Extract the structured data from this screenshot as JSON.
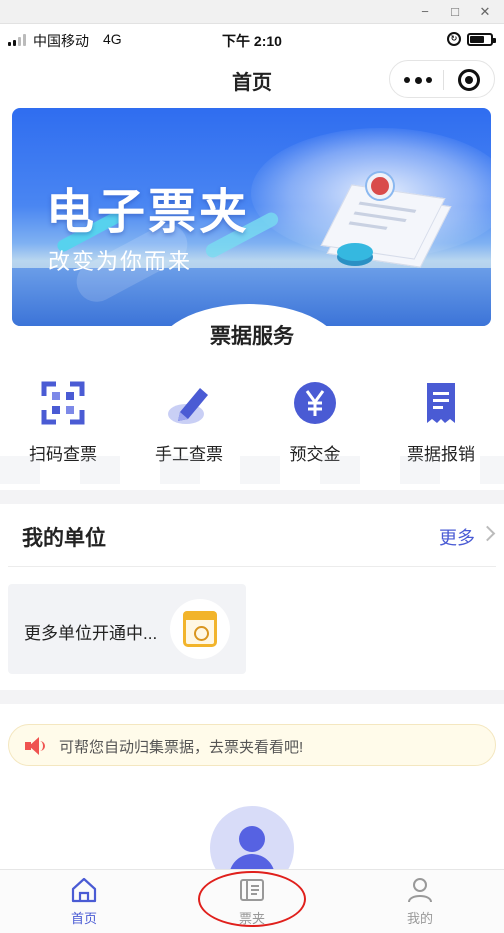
{
  "window": {
    "minimize": "−",
    "maximize": "□",
    "close": "✕"
  },
  "status_bar": {
    "carrier": "中国移动",
    "network": "4G",
    "time": "下午 2:10",
    "lock_icon": "rotation-lock-icon",
    "battery_icon": "battery-icon"
  },
  "nav": {
    "title": "首页",
    "menu_icon": "more-dots-icon",
    "close_icon": "target-icon"
  },
  "banner": {
    "title": "电子票夹",
    "subtitle": "改变为你而来"
  },
  "services": {
    "section_title": "票据服务",
    "items": [
      {
        "label": "扫码查票",
        "icon": "scan-icon"
      },
      {
        "label": "手工查票",
        "icon": "pen-icon"
      },
      {
        "label": "预交金",
        "icon": "yen-icon"
      },
      {
        "label": "票据报销",
        "icon": "receipt-icon"
      }
    ]
  },
  "my_unit": {
    "title": "我的单位",
    "more": "更多",
    "card_text": "更多单位开通中...",
    "card_icon": "calendar-clock-icon"
  },
  "notice": {
    "text": "可帮您自动归集票据，去票夹看看吧!",
    "icon": "speaker-icon"
  },
  "tabbar": {
    "tabs": [
      {
        "label": "首页",
        "icon": "home-icon",
        "active": true
      },
      {
        "label": "票夹",
        "icon": "ticket-folder-icon",
        "active": false
      },
      {
        "label": "我的",
        "icon": "user-icon",
        "active": false
      }
    ]
  },
  "colors": {
    "accent": "#4a5bd4",
    "icon_blue": "#4a5bd4",
    "banner_blue": "#2f6df0",
    "notice_bg": "#fffbea",
    "speaker_red": "#ef5350",
    "calendar_orange": "#f2b42b",
    "annotation_red": "#e0201c"
  }
}
